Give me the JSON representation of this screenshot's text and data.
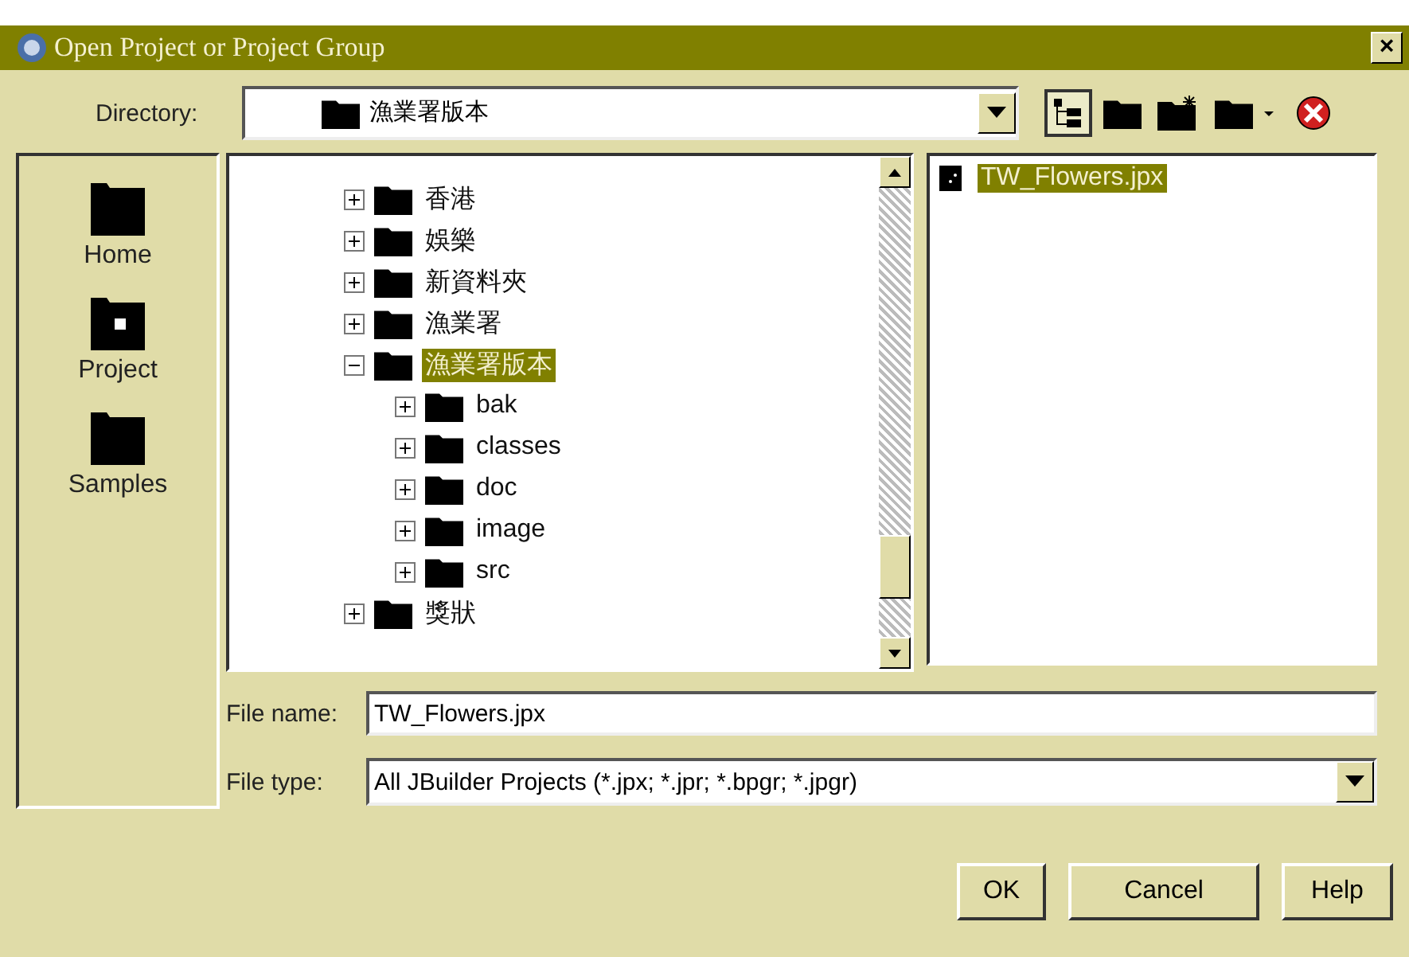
{
  "window": {
    "title": "Open Project or Project Group",
    "close": "×"
  },
  "directory": {
    "label": "Directory:",
    "value": "漁業署版本"
  },
  "shortcuts": [
    {
      "label": "Home"
    },
    {
      "label": "Project"
    },
    {
      "label": "Samples"
    }
  ],
  "tree": [
    {
      "label": "香港",
      "expanded": false,
      "selected": false
    },
    {
      "label": "娛樂",
      "expanded": false,
      "selected": false
    },
    {
      "label": "新資料夾",
      "expanded": false,
      "selected": false
    },
    {
      "label": "漁業署",
      "expanded": false,
      "selected": false
    },
    {
      "label": "漁業署版本",
      "expanded": true,
      "selected": true,
      "children": [
        {
          "label": "bak",
          "expanded": false,
          "selected": false
        },
        {
          "label": "classes",
          "expanded": false,
          "selected": false
        },
        {
          "label": "doc",
          "expanded": false,
          "selected": false
        },
        {
          "label": "image",
          "expanded": false,
          "selected": false
        },
        {
          "label": "src",
          "expanded": false,
          "selected": false
        }
      ]
    },
    {
      "label": "獎狀",
      "expanded": false,
      "selected": false
    }
  ],
  "files": [
    {
      "name": "TW_Flowers.jpx",
      "selected": true
    }
  ],
  "file_name": {
    "label": "File name:",
    "value": "TW_Flowers.jpx"
  },
  "file_type": {
    "label": "File type:",
    "value": "All JBuilder Projects (*.jpx; *.jpr; *.bpgr; *.jpgr)"
  },
  "buttons": [
    "OK",
    "Cancel",
    "Help"
  ]
}
